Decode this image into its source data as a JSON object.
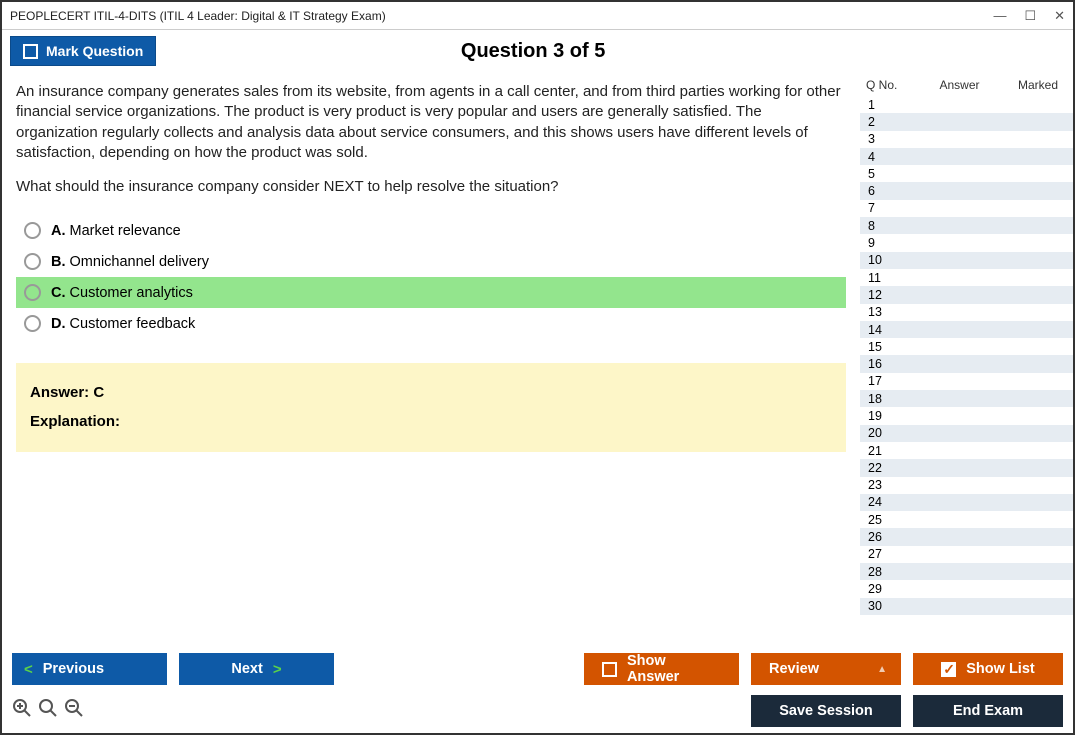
{
  "window": {
    "title": "PEOPLECERT ITIL-4-DITS (ITIL 4 Leader: Digital & IT Strategy Exam)"
  },
  "header": {
    "mark_label": "Mark Question",
    "question_label": "Question 3 of 5"
  },
  "question": {
    "para1": "An insurance company generates sales from its website, from agents in a call center, and from third parties working for other financial service organizations. The product is very product is very popular and users are generally satisfied. The organization regularly collects and analysis data about service consumers, and this shows users have different levels of satisfaction, depending on how the product was sold.",
    "para2": "What should the insurance company consider NEXT to help resolve the situation?",
    "options": [
      {
        "letter": "A.",
        "text": "Market relevance",
        "selected": false
      },
      {
        "letter": "B.",
        "text": "Omnichannel delivery",
        "selected": false
      },
      {
        "letter": "C.",
        "text": "Customer analytics",
        "selected": true
      },
      {
        "letter": "D.",
        "text": "Customer feedback",
        "selected": false
      }
    ]
  },
  "answer": {
    "line1": "Answer: C",
    "line2": "Explanation:"
  },
  "side": {
    "col_q": "Q No.",
    "col_a": "Answer",
    "col_m": "Marked",
    "rows": [
      1,
      2,
      3,
      4,
      5,
      6,
      7,
      8,
      9,
      10,
      11,
      12,
      13,
      14,
      15,
      16,
      17,
      18,
      19,
      20,
      21,
      22,
      23,
      24,
      25,
      26,
      27,
      28,
      29,
      30
    ]
  },
  "footer": {
    "previous": "Previous",
    "next": "Next",
    "show_answer": "Show Answer",
    "review": "Review",
    "show_list": "Show List",
    "save_session": "Save Session",
    "end_exam": "End Exam"
  }
}
